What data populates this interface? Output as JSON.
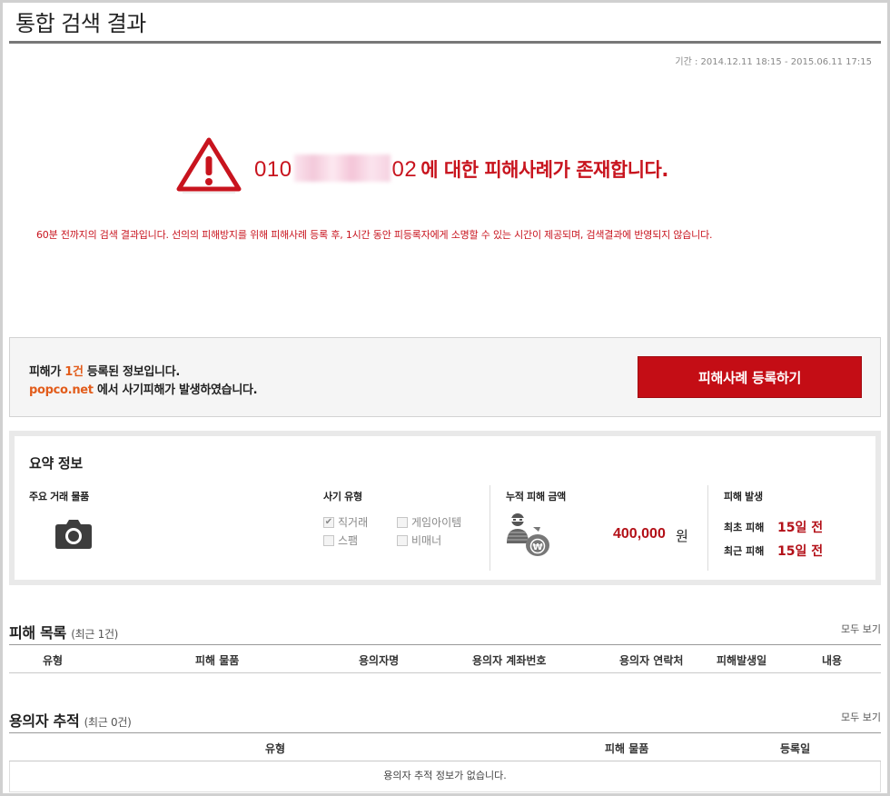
{
  "header": {
    "title": "통합 검색 결과",
    "period": "기간 : 2014.12.11 18:15 - 2015.06.11 17:15"
  },
  "alert": {
    "phone_prefix": "010",
    "phone_suffix": "02",
    "message": "에 대한 피해사례가 존재합니다.",
    "notice": "60분 전까지의 검색 결과입니다. 선의의 피해방지를 위해 피해사례 등록 후, 1시간 동안 피등록자에게 소명할 수 있는 시간이 제공되며, 검색결과에 반영되지 않습니다."
  },
  "register": {
    "line1_pre": "피해가 ",
    "count": "1건",
    "line1_post": " 등록된 정보입니다.",
    "site": "popco.net",
    "line2_post": " 에서 사기피해가 발생하였습니다.",
    "button": "피해사례 등록하기"
  },
  "summary": {
    "title": "요약 정보",
    "items_label": "주요 거래 물품",
    "item_icon": "camera-icon",
    "fraud_type_label": "사기 유형",
    "fraud_types": [
      {
        "label": "직거래",
        "checked": true
      },
      {
        "label": "게임아이템",
        "checked": false
      },
      {
        "label": "스팸",
        "checked": false
      },
      {
        "label": "비매너",
        "checked": false
      }
    ],
    "amount_label": "누적 피해 금액",
    "amount": "400,000",
    "amount_unit": "원",
    "occur_label": "피해 발생",
    "first_label": "최초 피해",
    "first_value": "15일 전",
    "recent_label": "최근 피해",
    "recent_value": "15일 전"
  },
  "damage_list": {
    "title": "피해 목록",
    "sub": "(최근 1건)",
    "see_all": "모두 보기",
    "columns": [
      "유형",
      "피해 물품",
      "용의자명",
      "용의자 계좌번호",
      "용의자 연락처",
      "피해발생일",
      "내용"
    ]
  },
  "suspect_track": {
    "title": "용의자 추적",
    "sub": "(최근 0건)",
    "see_all": "모두 보기",
    "columns": [
      "유형",
      "피해 물품",
      "등록일"
    ],
    "empty": "용의자 추적 정보가 없습니다."
  },
  "colors": {
    "accent_red": "#c40d15",
    "highlight_orange": "#e25c1b"
  }
}
